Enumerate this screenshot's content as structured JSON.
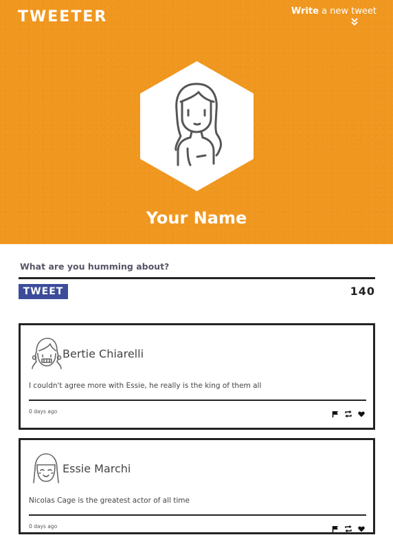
{
  "header": {
    "logo": "TWEETER",
    "compose_toggle_strong": "Write",
    "compose_toggle_rest": " a new tweet",
    "compose_toggle_icon": "double-chevron-down-icon",
    "profile_name": "Your Name",
    "background_color": "#f0971f"
  },
  "compose": {
    "placeholder": "What are you humming about?",
    "value": "",
    "tweet_button": "TWEET",
    "char_counter": "140",
    "button_color": "#3c4c9b"
  },
  "tweets": [
    {
      "author": "Bertie Chiarelli",
      "text": "I couldn't agree more with Essie, he really is the king of them all",
      "time": "0 days ago",
      "avatar_icon": "girl-avatar-icon",
      "actions": [
        "flag-icon",
        "retweet-icon",
        "heart-icon"
      ]
    },
    {
      "author": "Essie Marchi",
      "text": "Nicolas Cage is the greatest actor of all time",
      "time": "0 days ago",
      "avatar_icon": "girl-avatar-icon",
      "actions": [
        "flag-icon",
        "retweet-icon",
        "heart-icon"
      ]
    }
  ]
}
